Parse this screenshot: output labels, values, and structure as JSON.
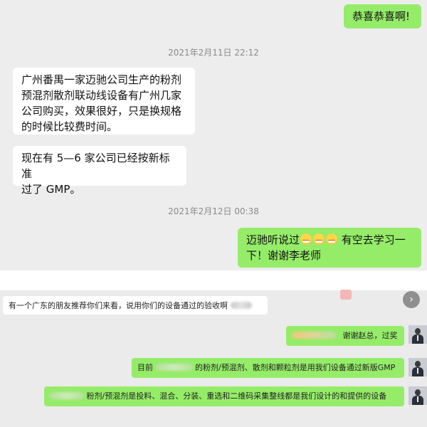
{
  "top_chat": {
    "msg1": "恭喜恭喜啊!",
    "ts1": "2021年2月11日 22:12",
    "msg2_lines": [
      "广州番禺一家迈驰公司生产的粉剂",
      "预混剂散剂联动线设备有广州几家",
      "公司购买，效果很好，只是换规格",
      "的时候比较费时间。"
    ],
    "msg3_lines": [
      "现在有 5—6 家公司已经按新标准",
      "过了 GMP。"
    ],
    "ts2": "2021年2月12日 00:38",
    "msg4_before": "迈驰听说过",
    "msg4_after": " 有空去学习一",
    "msg4_line2": "下！谢谢李老师"
  },
  "bottom_chat": {
    "msg1": "有一个广东的朋友推荐你们来看，说用你们的设备通过的验收啊",
    "msg2": "谢谢赵总，过奖",
    "msg3_before": "目前",
    "msg3_after": "的粉剂/预混剂、散剂和颗粒剂是用我们设备通过新版GMP",
    "msg4": "粉剂/预混剂是投料、混合、分装、重选和二维码采集整线都是我们设计的和提供的设备",
    "scroll_icon": "chevron-right-icon"
  }
}
